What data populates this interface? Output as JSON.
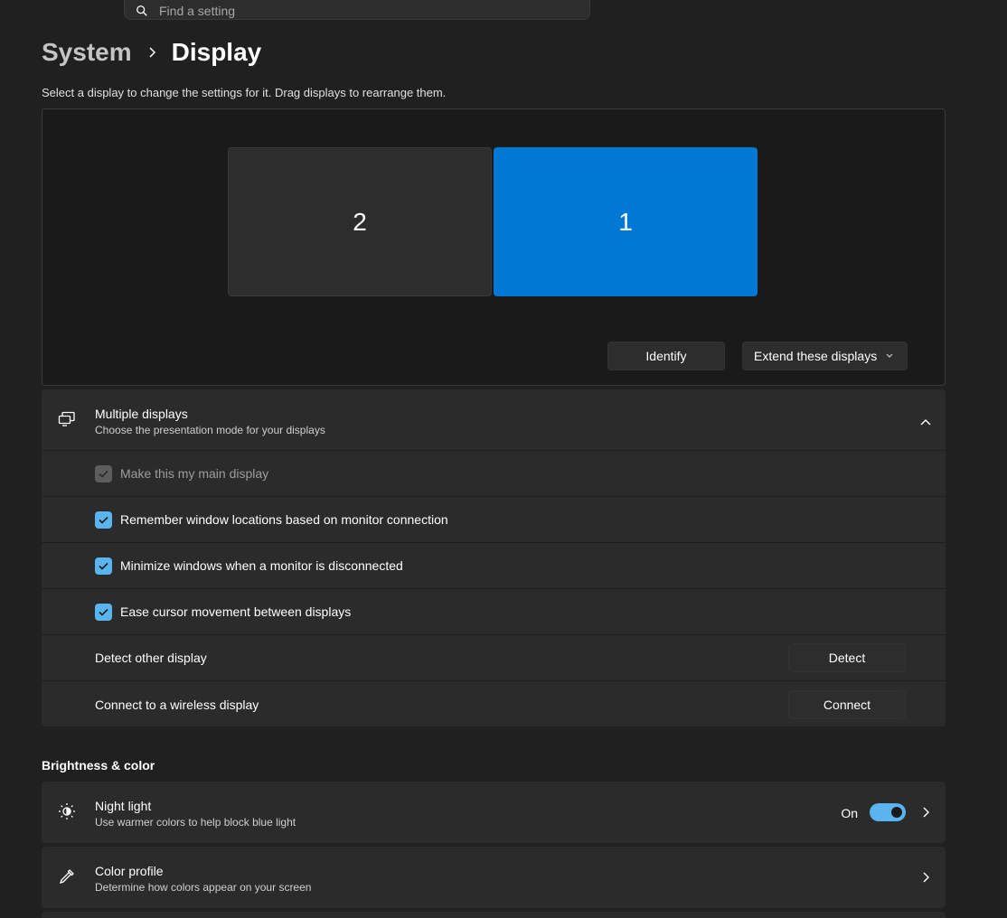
{
  "search": {
    "placeholder": "Find a setting"
  },
  "breadcrumb": {
    "parent": "System",
    "current": "Display"
  },
  "hint": "Select a display to change the settings for it. Drag displays to rearrange them.",
  "arrangement": {
    "monitors": [
      {
        "label": "2"
      },
      {
        "label": "1"
      }
    ],
    "identify_label": "Identify",
    "mode_label": "Extend these displays"
  },
  "multiple_displays": {
    "title": "Multiple displays",
    "subtitle": "Choose the presentation mode for your displays",
    "options": [
      {
        "label": "Make this my main display",
        "checked": true,
        "disabled": true
      },
      {
        "label": "Remember window locations based on monitor connection",
        "checked": true
      },
      {
        "label": "Minimize windows when a monitor is disconnected",
        "checked": true
      },
      {
        "label": "Ease cursor movement between displays",
        "checked": true
      }
    ],
    "detect": {
      "label": "Detect other display",
      "button": "Detect"
    },
    "connect": {
      "label": "Connect to a wireless display",
      "button": "Connect"
    }
  },
  "brightness_section": {
    "title": "Brightness & color"
  },
  "night_light": {
    "title": "Night light",
    "subtitle": "Use warmer colors to help block blue light",
    "state_label": "On"
  },
  "color_profile": {
    "title": "Color profile",
    "subtitle": "Determine how colors appear on your screen"
  },
  "colors": {
    "accent": "#0078d4",
    "check": "#5ab4f0",
    "background": "#202020",
    "card": "#2b2b2b"
  }
}
